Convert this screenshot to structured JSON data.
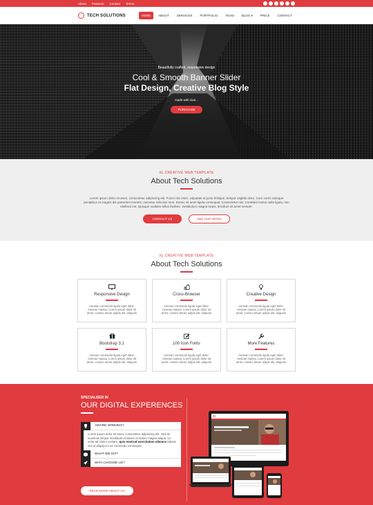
{
  "topbar": {
    "links": [
      "About",
      "Features",
      "Contact",
      "Terms"
    ],
    "social_icons": [
      "facebook-icon",
      "twitter-icon",
      "pinterest-icon",
      "google-plus-icon",
      "linkedin-icon",
      "youtube-icon"
    ]
  },
  "header": {
    "logo_text": "TECH SOLUTIONS",
    "nav": [
      "HOME",
      "ABOUT",
      "SERVICES",
      "PORTFOLIO",
      "TEAM",
      "BLOG ▾",
      "PRICE",
      "CONTACT"
    ],
    "active_index": 0
  },
  "hero": {
    "small": "Beautifully crafted, responsive design",
    "line1": "Cool & Smooth Banner Slider",
    "line2": "Flat Design, Creative Blog Style",
    "made": "made with love...",
    "button": "PURCHASE"
  },
  "about": {
    "kicker": "XL CREATIVE WEB TEMPLATE",
    "title": "About Tech Solutions",
    "text": "Lorem ipsum dolor sit amet, consectetur adipiscing elit. Fusce nisi enim, vulputate at justo tristique, tempor sagittis dolor. Cum sociis natoque penatibus et magnis dis parturient montes, nascetur ridiculus mus. Donec sit amet ligula consequat, consectetur nisi. Curabitur luctus nulla ligula, non eleifend est. Quisque sodales tellus facilisis. Vestibulum magna turpis, tincidunt sit amet semper.",
    "btn_contact": "CONTACT US",
    "btn_work": "SEE OUR WORK"
  },
  "features": {
    "kicker": "XL CREATIVE WEB TEMPLATE",
    "title": "About Tech Solutions",
    "cards": [
      {
        "icon": "monitor-icon",
        "glyph": "🖵",
        "title": "Responsive Design",
        "text": "Aenean commodo ligula eget dolor. Aenean massa. Lorem ipsum dolor sit amet, consec tetuer adipis elit, aliquam"
      },
      {
        "icon": "thumbs-up-icon",
        "glyph": "👍",
        "title": "Cross-Browser",
        "text": "Aenean commodo ligula eget dolor. Aenean massa. Lorem ipsum dolor sit amet, consec tetuer adipis elit, aliquam"
      },
      {
        "icon": "lightbulb-icon",
        "glyph": "💡",
        "title": "Creative Design",
        "text": "Aenean commodo ligula eget dolor. Aenean massa. Lorem ipsum dolor sit amet, consec tetuer adipis elit, aliquam"
      },
      {
        "icon": "gift-icon",
        "glyph": "🎁",
        "title": "Bootstrap 3.1",
        "text": "Aenean commodo ligula eget dolor. Aenean massa. Lorem ipsum dolor sit amet, consec tetuer adipis elit, aliquam"
      },
      {
        "icon": "edit-icon",
        "glyph": "✎",
        "title": "100 Icon Fonts",
        "text": "Aenean commodo ligula eget dolor. Aenean massa. Lorem ipsum dolor sit amet, consec tetuer adipis elit, aliquam"
      },
      {
        "icon": "wrench-icon",
        "glyph": "🔧",
        "title": "More Features",
        "text": "Aenean commodo ligula eget dolor. Aenean massa. Lorem ipsum dolor sit amet, consec tetuer adipis elit, aliquam"
      }
    ]
  },
  "digital": {
    "kicker": "SPECIALISED IN",
    "title": "OUR DIGITAL EXPERENCES",
    "acc1_title": "AWARD WINNING?",
    "acc1_text_a": "Lorem ipsum dolor sit amet, consectetur adipiscing elit. Sed do eiusmod tempor incididunt ut labore et dolore magna aliqua. Ut enim ad minim veniam, ",
    "acc1_text_bold": "quis nostrud exercitation ullamco",
    "acc1_text_b": " laboris nisi ut aliquip ex ea commodo consequat.",
    "acc2_title": "WHAT WE DO?",
    "acc3_title": "WHY CHOOSE US?",
    "button": "READ MORE ABOUT US",
    "mock_screen_text": "Flat Responsive Retina Ready Theme!",
    "mock_logo": "TECH SOLUTIONS"
  },
  "colors": {
    "accent": "#e03b3e",
    "dark": "#222222"
  }
}
